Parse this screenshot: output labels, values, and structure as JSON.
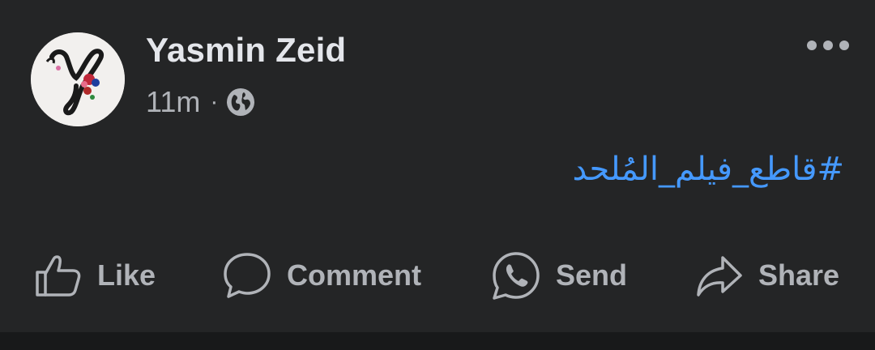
{
  "post": {
    "author_name": "Yasmin Zeid",
    "time": "11m",
    "separator": "·",
    "privacy_icon": "globe-icon",
    "text": "#قاطع_فيلم_المُلحد",
    "more_icon": "more-options-icon"
  },
  "actions": {
    "like": {
      "label": "Like",
      "icon": "thumbs-up-icon"
    },
    "comment": {
      "label": "Comment",
      "icon": "comment-bubble-icon"
    },
    "send": {
      "label": "Send",
      "icon": "whatsapp-icon"
    },
    "share": {
      "label": "Share",
      "icon": "share-arrow-icon"
    }
  },
  "colors": {
    "background": "#242526",
    "name": "#e4e6eb",
    "secondary": "#b0b3b8",
    "hashtag": "#4599ff"
  }
}
